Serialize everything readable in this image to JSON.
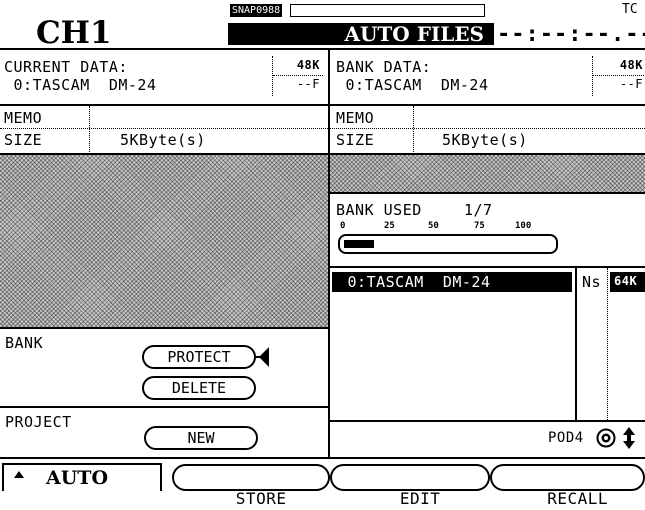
{
  "header": {
    "channel": "CH1",
    "snap_label": "SNAP0988",
    "title": "AUTO FILES",
    "time_code": "--:--:--.--",
    "tc_label": "TC"
  },
  "current": {
    "label": "CURRENT DATA:",
    "entry": " 0:TASCAM  DM-24",
    "rate": "48K",
    "mode": "--F",
    "memo_label": "MEMO",
    "memo_value": "",
    "size_label": "SIZE",
    "size_value": "5KByte(s)"
  },
  "bank_data": {
    "label": "BANK DATA:",
    "entry": " 0:TASCAM  DM-24",
    "rate": "48K",
    "mode": "--F",
    "memo_label": "MEMO",
    "memo_value": "",
    "size_label": "SIZE",
    "size_value": "5KByte(s)"
  },
  "bank_used": {
    "label": "BANK USED",
    "count": "1/7",
    "fraction": 0.143,
    "scale": [
      "0",
      "25",
      "50",
      "75",
      "100"
    ]
  },
  "bank_list": {
    "selected_entry": " 0:TASCAM  DM-24",
    "col_ns": "Ns",
    "col_rate": "64K"
  },
  "bank_section": {
    "label": "BANK",
    "protect_label": "PROTECT",
    "delete_label": "DELETE"
  },
  "project_section": {
    "label": "PROJECT",
    "new_label": "NEW"
  },
  "pod": {
    "label": "POD4"
  },
  "tabs": {
    "auto_label": "AUTO",
    "store_label": "STORE",
    "edit_label": "EDIT",
    "recall_label": "RECALL"
  }
}
